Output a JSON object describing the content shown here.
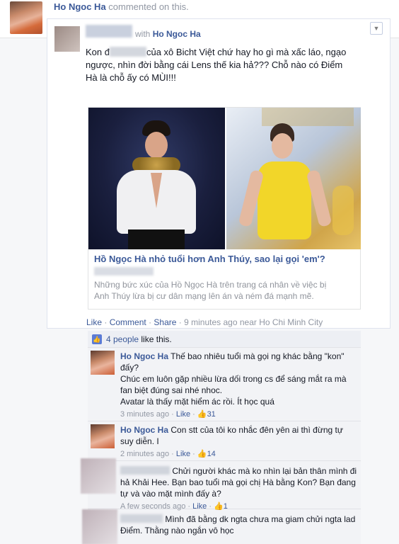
{
  "activity": {
    "name": "Ho Ngoc Ha",
    "suffix": "commented on this."
  },
  "story": {
    "with_prefix": "with",
    "tagged_name": "Ho Ngoc Ha",
    "dropdown_icon": "chevron-down-icon",
    "text_part1": "Kon đ",
    "text_part2": "của xô Bicht Việt chứ hay ho gì mà xấc láo, ngạo ngược, nhìn đời bằng cái Lens thế kia hả??? Chỗ nào có Điểm Hà là chỗ ấy có MÙI!!!",
    "link": {
      "title": "Hồ Ngọc Hà nhỏ tuổi hơn Anh Thúy, sao lại gọi 'em'?",
      "description": "Những bức xúc của Hồ Ngọc Hà trên trang cá nhân về việc bị Anh Thúy lừa bị cư dân mạng lên án và ném đá mạnh mẽ."
    },
    "actions": {
      "like": "Like",
      "comment": "Comment",
      "share": "Share",
      "time": "9 minutes ago near Ho Chi Minh City",
      "sep": "·"
    }
  },
  "likes": {
    "count_text": "4 people",
    "suffix": "like this."
  },
  "comments": [
    {
      "name": "Ho Ngoc Ha",
      "text": "Thế bao nhiêu tuổi mà gọi ng khác bằng \"kon\" đấy?",
      "text2": "Chúc em luôn gặp nhiều lừa dối trong cs để sáng mắt ra mà fan biệt đúng sai nhé nhoc.",
      "text3": "Avatar là thấy mặt hiểm ác rồi. Ít học quá",
      "time": "3 minutes ago",
      "like": "Like",
      "likes": "31"
    },
    {
      "name": "Ho Ngoc Ha",
      "text": "Con stt của tôi ko nhắc đên yên ai thì đừng tự suy diễn. I",
      "time": "2 minutes ago",
      "like": "Like",
      "likes": "14"
    },
    {
      "text": "Chửi người khác mà ko nhìn lại bản thân mình đi hả Khải Hee. Bạn bao tuổi mà gọi chị Hà bằng Kon? Bạn đang tự và vào mặt mình đấy à?",
      "time": "A few seconds ago",
      "like": "Like",
      "likes": "1"
    },
    {
      "text": "Mình đã bằng dk ngta chưa ma giam chửi ngta lad Điểm. Thằng nào ngắn vô học"
    }
  ]
}
